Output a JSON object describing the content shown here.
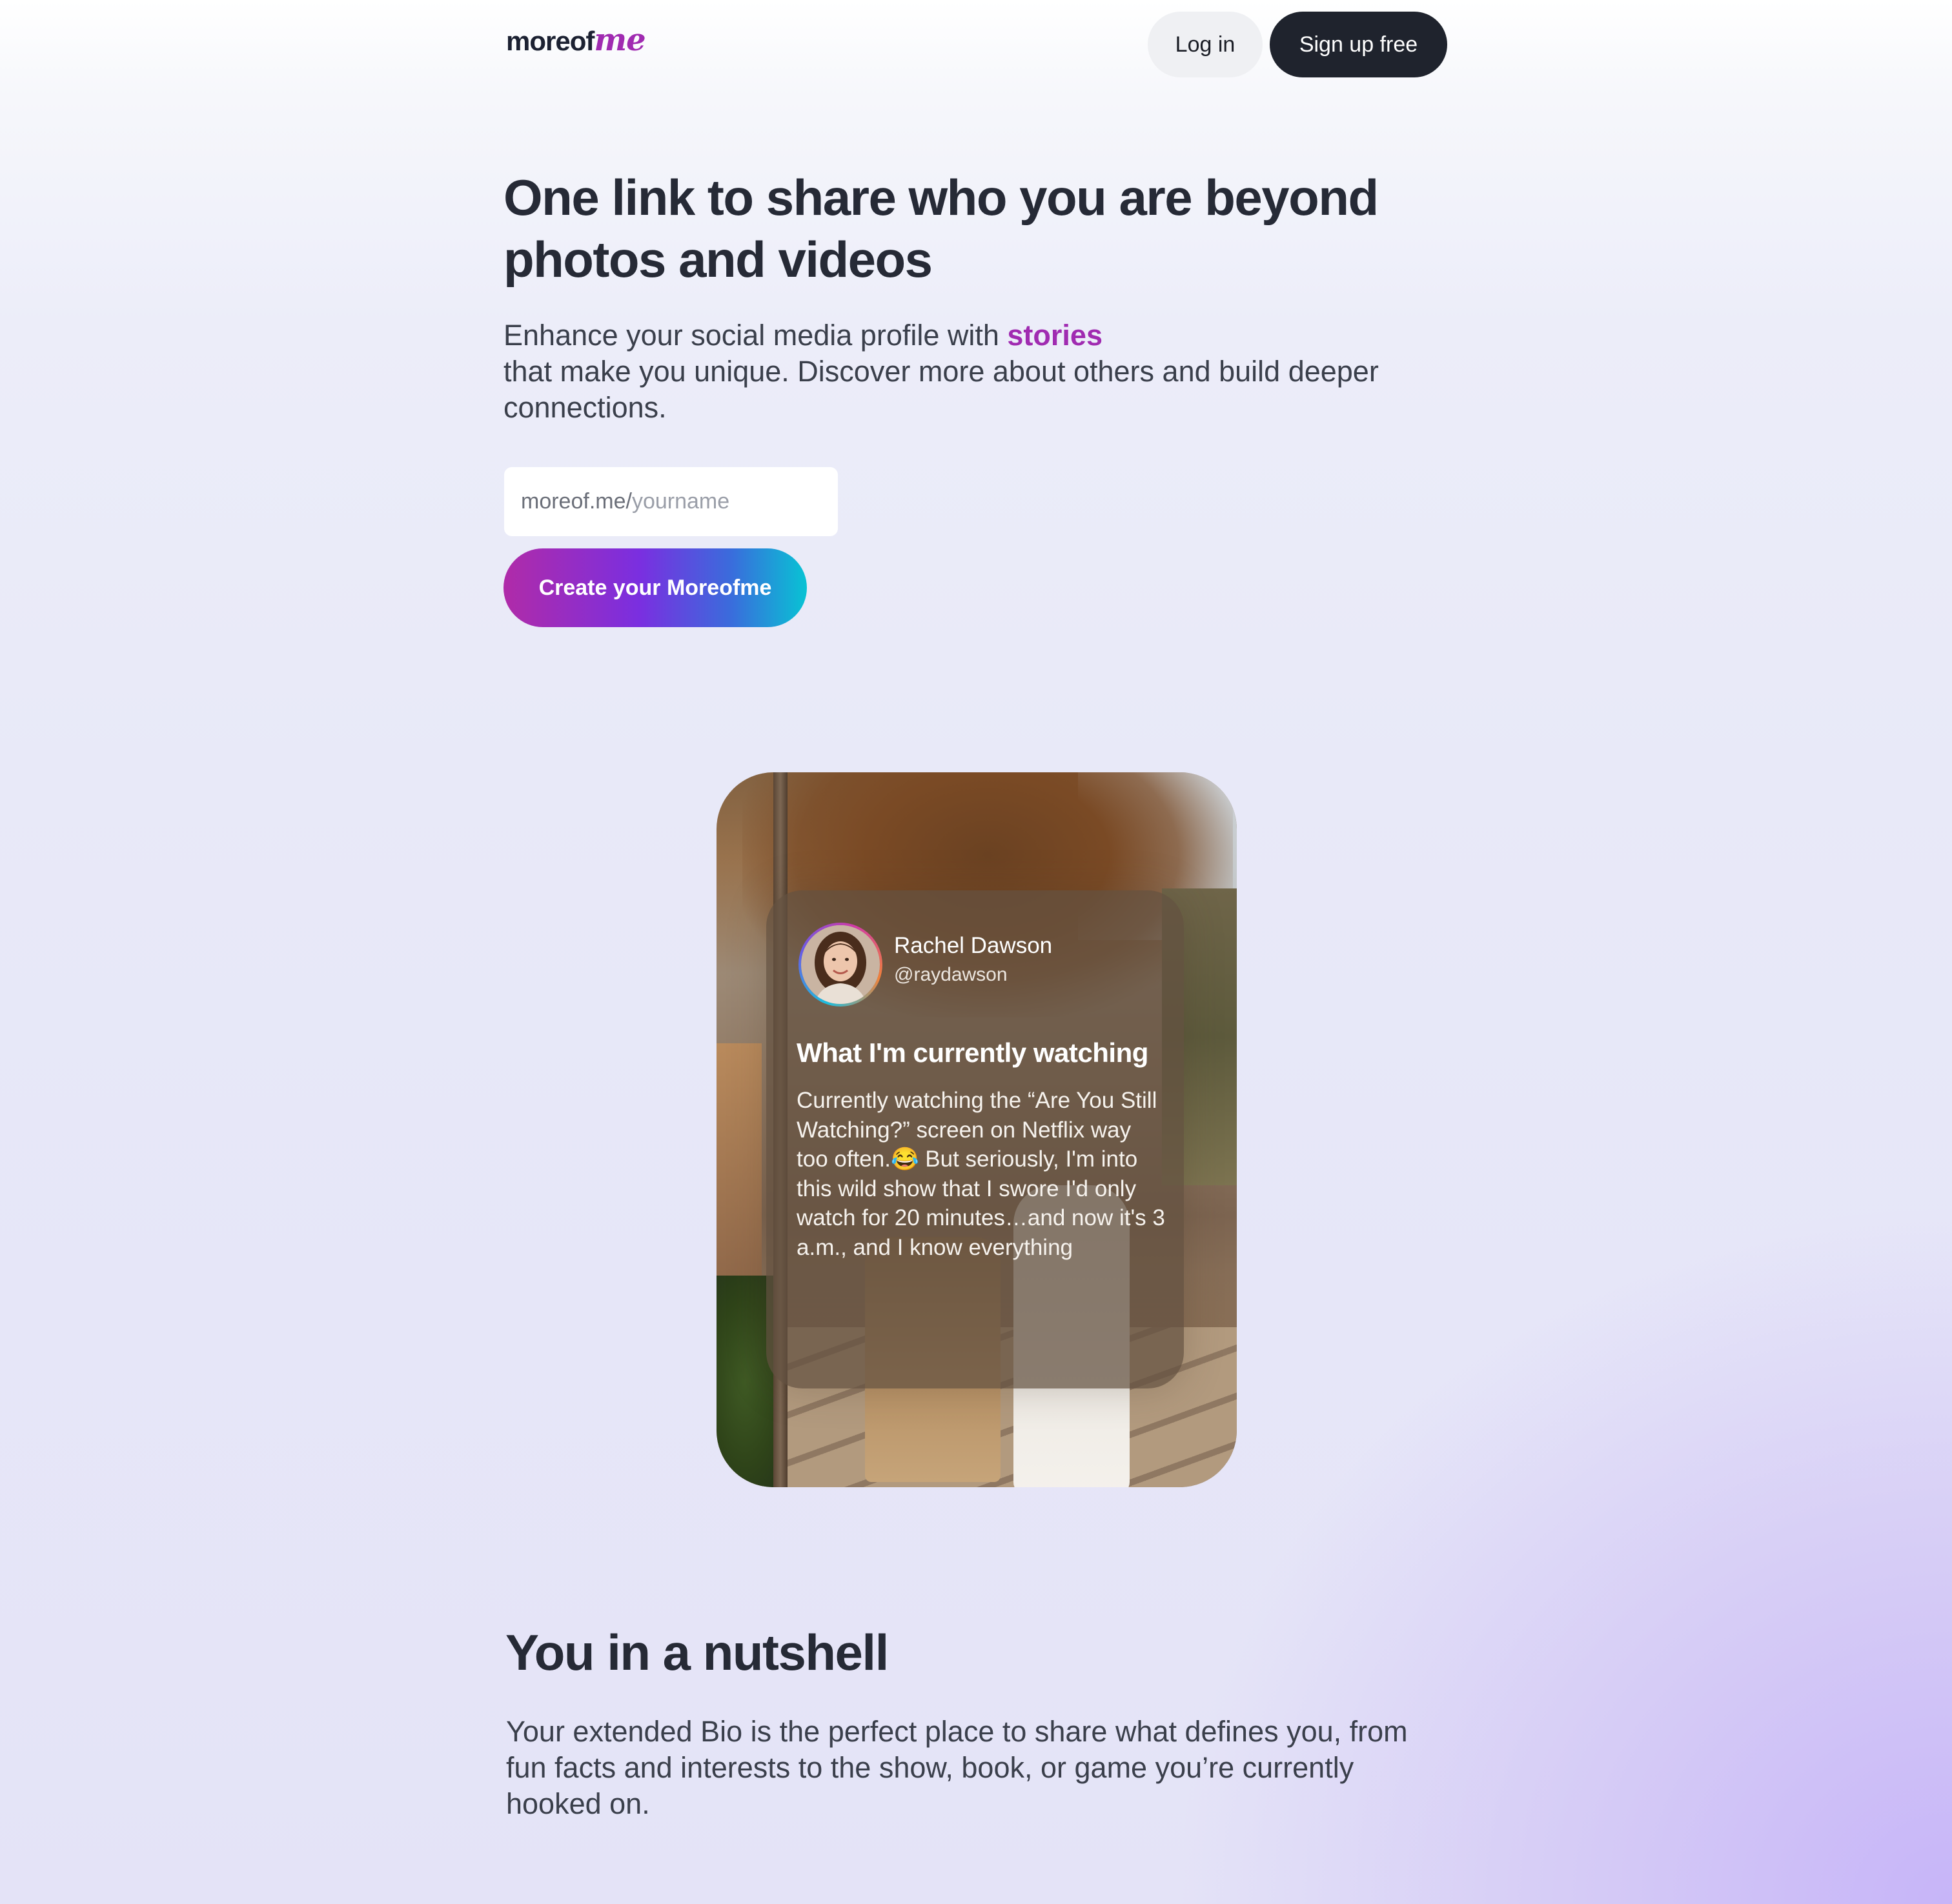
{
  "header": {
    "logo_main": "moreof",
    "logo_accent": "me",
    "login_label": "Log in",
    "signup_label": "Sign up free"
  },
  "hero": {
    "title": "One link to share who you are beyond photos and videos",
    "subtitle_before": "Enhance your social media profile with ",
    "subtitle_accent": "stories",
    "subtitle_after": "that make you unique. Discover more about others and build deeper connections.",
    "url_prefix": "moreof.me/",
    "url_placeholder": "yourname",
    "cta_label": "Create your Moreofme"
  },
  "story_card": {
    "user_name": "Rachel Dawson",
    "user_handle": "@raydawson",
    "heading": "What I'm currently watching",
    "text": "Currently watching the “Are You Still Watching?” screen on Netflix way too often.😂 But seriously, I'm into this wild show that I swore I'd only watch for 20 minutes…and now it's 3 a.m., and I know everything"
  },
  "nutshell": {
    "title": "You in a nutshell",
    "text": "Your extended Bio is the perfect place to share what defines you, from fun facts and interests to the show, book, or game you’re currently hooked on."
  },
  "colors": {
    "accent": "#a02bb1",
    "dark_button": "#1f232d",
    "light_button": "#eff0f3",
    "cta_gradient": [
      "#b02ba8",
      "#7a2fe0",
      "#3a6cdc",
      "#08c3d4"
    ]
  }
}
